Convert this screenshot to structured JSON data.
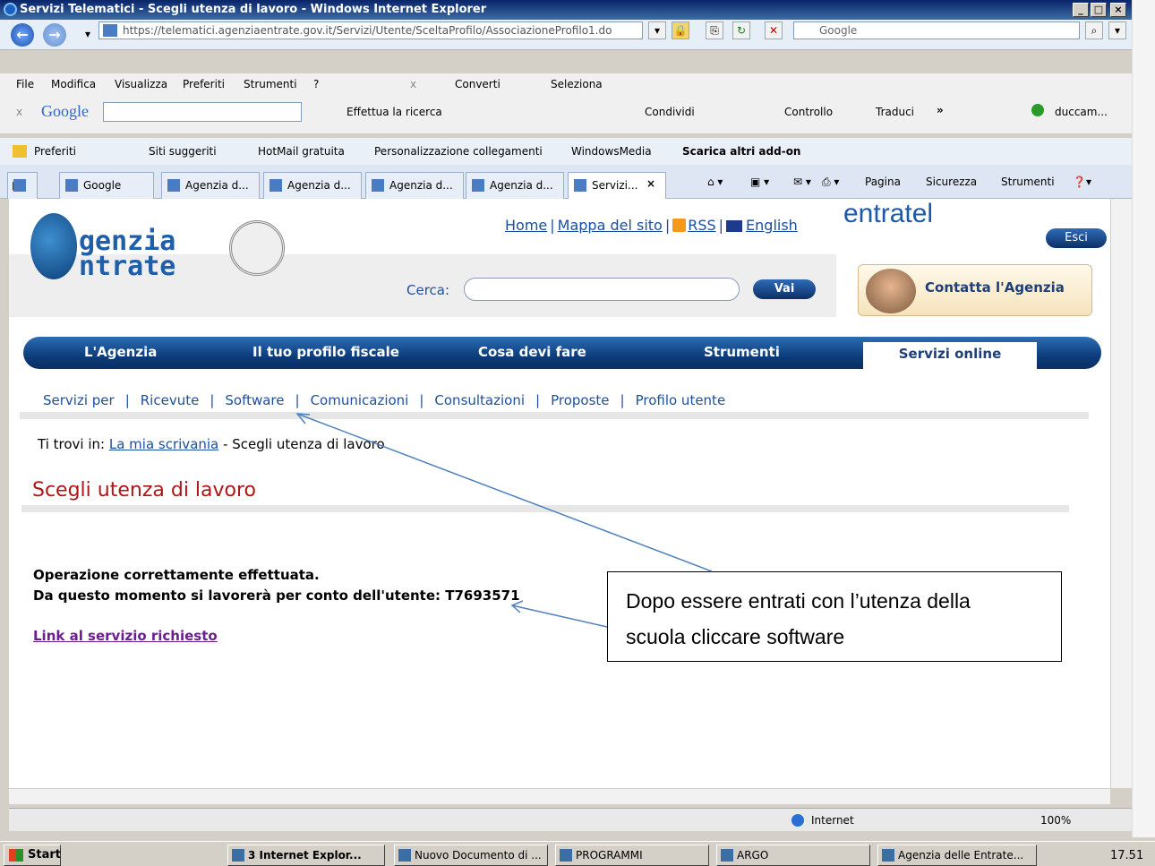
{
  "window": {
    "title": "Servizi Telematici - Scegli utenza di lavoro - Windows Internet Explorer",
    "min": "_",
    "max": "□",
    "close": "×"
  },
  "address": {
    "url": "https://telematici.agenziaentrate.gov.it/Servizi/Utente/SceltaProfilo/AssociazioneProfilo1.do",
    "search_placeholder": "Google"
  },
  "menu": {
    "items": [
      "File",
      "Modifica",
      "Visualizza",
      "Preferiti",
      "Strumenti",
      "?"
    ],
    "converti": "Converti",
    "seleziona": "Seleziona"
  },
  "google_toolbar": {
    "logo": "Google",
    "effettua": "Effettua la ricerca",
    "condividi": "Condividi",
    "controllo": "Controllo",
    "traduci": "Traduci",
    "user": "duccam..."
  },
  "favorites": {
    "preferiti": "Preferiti",
    "items": [
      "Siti suggeriti",
      "HotMail gratuita",
      "Personalizzazione collegamenti",
      "WindowsMedia",
      "Scarica altri add-on"
    ]
  },
  "tabs": [
    {
      "label": "Google"
    },
    {
      "label": "Agenzia d..."
    },
    {
      "label": "Agenzia d..."
    },
    {
      "label": "Agenzia d..."
    },
    {
      "label": "Agenzia d..."
    },
    {
      "label": "Servizi..."
    }
  ],
  "commandbar": {
    "pagina": "Pagina",
    "sicurezza": "Sicurezza",
    "strumenti": "Strumenti"
  },
  "page": {
    "logo_line1": "genzia",
    "logo_line2": "ntrate",
    "links": {
      "home": "Home",
      "mappa": "Mappa del sito",
      "rss": "RSS",
      "english": "English"
    },
    "entratel": "entratel",
    "esci": "Esci",
    "cerca_label": "Cerca:",
    "vai": "Vai",
    "contatta": "Contatta l'Agenzia",
    "nav": [
      "L'Agenzia",
      "Il tuo profilo fiscale",
      "Cosa devi fare",
      "Strumenti"
    ],
    "nav_active": "Servizi online",
    "subnav": [
      "Servizi per",
      "Ricevute",
      "Software",
      "Comunicazioni",
      "Consultazioni",
      "Proposte",
      "Profilo utente"
    ],
    "breadcrumb_prefix": "Ti trovi in:",
    "breadcrumb_link": "La mia scrivania",
    "breadcrumb_current": "- Scegli utenza di lavoro",
    "title": "Scegli utenza di lavoro",
    "message1": "Operazione correttamente effettuata.",
    "message2": "Da questo momento si lavorerà per conto dell'utente: T7693571",
    "service_link": "Link al servizio richiesto"
  },
  "callout": {
    "line1": "Dopo essere entrati con l’utenza  della",
    "line2": "scuola cliccare software"
  },
  "status": {
    "zone": "Internet",
    "zoom": "100%"
  },
  "taskbar": {
    "start": "Start",
    "items": [
      "3 Internet Explor...",
      "Nuovo Documento di ...",
      "PROGRAMMI",
      "ARGO",
      "Agenzia delle Entrate..."
    ],
    "clock": "17.51"
  }
}
